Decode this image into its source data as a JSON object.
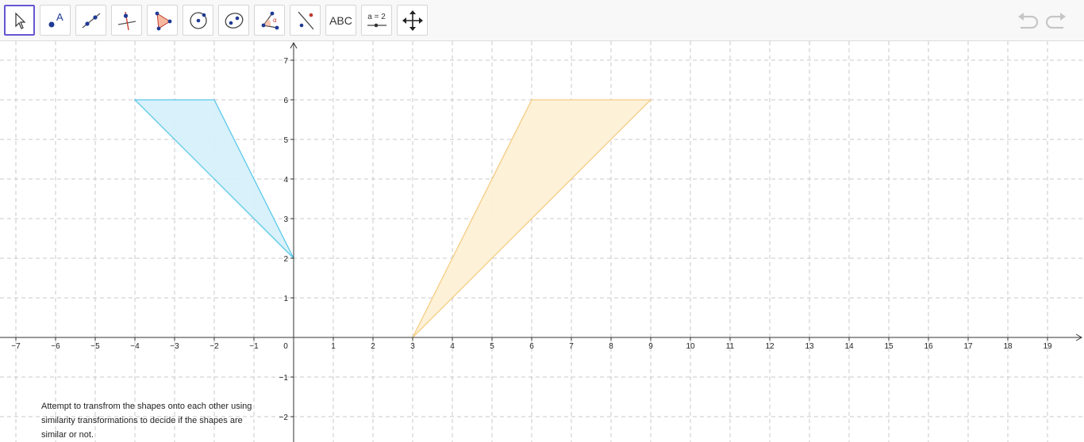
{
  "toolbar": {
    "tools": [
      {
        "name": "move-tool",
        "icon": "pointer-arrow-icon",
        "selected": true
      },
      {
        "name": "point-tool",
        "icon": "point-with-label-icon",
        "label": "A"
      },
      {
        "name": "line-tool",
        "icon": "line-through-two-points-icon"
      },
      {
        "name": "perpendicular-line-tool",
        "icon": "perpendicular-line-icon"
      },
      {
        "name": "polygon-tool",
        "icon": "polygon-icon"
      },
      {
        "name": "circle-tool",
        "icon": "circle-with-center-icon"
      },
      {
        "name": "ellipse-tool",
        "icon": "ellipse-icon"
      },
      {
        "name": "angle-tool",
        "icon": "angle-icon",
        "label": "α"
      },
      {
        "name": "reflect-tool",
        "icon": "reflect-about-line-icon"
      },
      {
        "name": "text-tool",
        "icon": "text-icon",
        "label": "ABC"
      },
      {
        "name": "slider-tool",
        "icon": "slider-icon",
        "label": "a = 2"
      },
      {
        "name": "move-graphics-view-tool",
        "icon": "move-arrows-icon"
      }
    ],
    "undo_icon": "undo-icon",
    "redo_icon": "redo-icon"
  },
  "graph": {
    "x_range": [
      -7,
      19
    ],
    "y_range": [
      -2,
      7
    ],
    "grid": true,
    "x_ticks": [
      "−7",
      "−6",
      "−5",
      "−4",
      "−3",
      "−2",
      "−1",
      "0",
      "1",
      "2",
      "3",
      "4",
      "5",
      "6",
      "7",
      "8",
      "9",
      "10",
      "11",
      "12",
      "13",
      "14",
      "15",
      "16",
      "17",
      "18",
      "19"
    ],
    "y_ticks": [
      "7",
      "6",
      "5",
      "4",
      "3",
      "2",
      "1",
      "−1",
      "−2"
    ],
    "origin_label": "0",
    "shapes": [
      {
        "name": "blue-triangle",
        "vertices": [
          [
            -4,
            6
          ],
          [
            -2,
            6
          ],
          [
            0,
            2
          ]
        ],
        "fill": "#d6f0fb",
        "stroke": "#5bc8ea"
      },
      {
        "name": "orange-triangle",
        "vertices": [
          [
            3,
            0
          ],
          [
            6,
            6
          ],
          [
            9,
            6
          ]
        ],
        "fill": "#fdf0d5",
        "stroke": "#f5cd85"
      }
    ]
  },
  "caption": {
    "text": "Attempt to transfrom the shapes onto each other using similarity transformations to decide if the shapes are similar or not."
  }
}
